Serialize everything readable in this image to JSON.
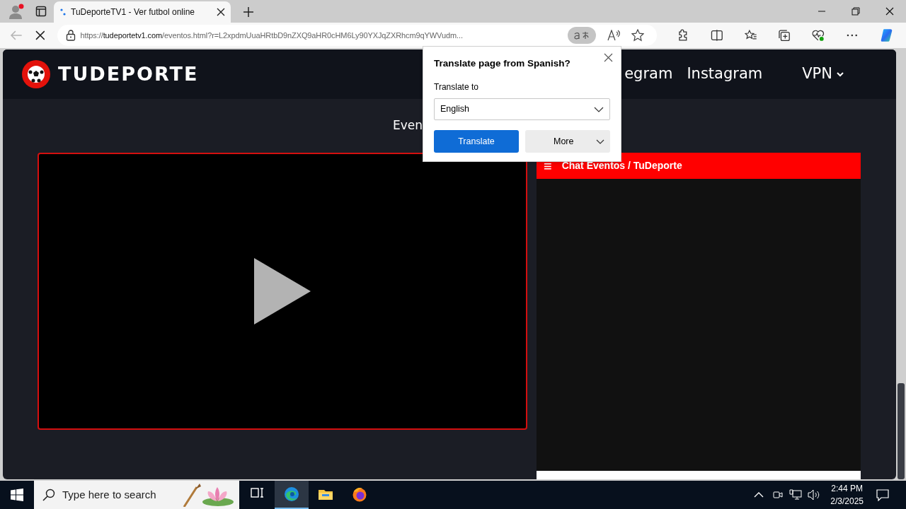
{
  "browser": {
    "tabs": [
      {
        "title": "TuDeporteTV1 - Ver futbol online",
        "selected": true
      }
    ],
    "address": {
      "domain": "tudeportetv1.com",
      "url_rest": "/eventos.html?r=L2xpdmUuaHRtbD9nZXQ9aHR0cHM6Ly90YXJqZXRhcm9qYWVudm...",
      "prefix": "https://"
    },
    "loading": true
  },
  "site": {
    "logo_text": "TUDEPORTE",
    "nav": [
      {
        "label": "egram",
        "has_menu": false
      },
      {
        "label": "Instagram",
        "has_menu": false
      },
      {
        "label": "VPN",
        "has_menu": true
      }
    ],
    "heading": "Even",
    "chat": {
      "menu_glyph": "≡",
      "title": "Chat Eventos / TuDeporte"
    }
  },
  "translate_popup": {
    "title": "Translate page from Spanish?",
    "label": "Translate to",
    "language": "English",
    "primary_button": "Translate",
    "secondary_button": "More"
  },
  "taskbar": {
    "search_placeholder": "Type here to search",
    "apps": [
      {
        "kind": "taskview",
        "selected": false
      },
      {
        "kind": "edge",
        "selected": true
      },
      {
        "kind": "files",
        "selected": false
      },
      {
        "kind": "firefox",
        "selected": false
      }
    ],
    "time": "2:44 PM",
    "date": "2/3/2025"
  }
}
